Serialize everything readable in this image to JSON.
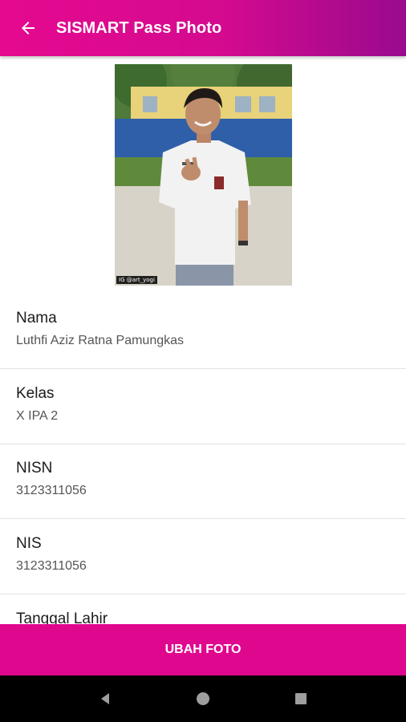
{
  "app_bar": {
    "title": "SISMART Pass Photo",
    "back_icon": "arrow-left-icon",
    "gradient_start": "#e5098f",
    "gradient_end": "#9a0a8e"
  },
  "photo": {
    "watermark": "IG @art_yogi"
  },
  "fields": [
    {
      "label": "Nama",
      "value": "Luthfi Aziz Ratna Pamungkas"
    },
    {
      "label": "Kelas",
      "value": "X IPA 2"
    },
    {
      "label": "NISN",
      "value": "3123311056"
    },
    {
      "label": "NIS",
      "value": "3123311056"
    },
    {
      "label": "Tanggal Lahir",
      "value": ""
    }
  ],
  "action_button": {
    "label": "UBAH FOTO",
    "color": "#e0078f"
  },
  "system_nav": {
    "back_icon": "triangle-back-icon",
    "home_icon": "circle-home-icon",
    "recents_icon": "square-recents-icon"
  }
}
